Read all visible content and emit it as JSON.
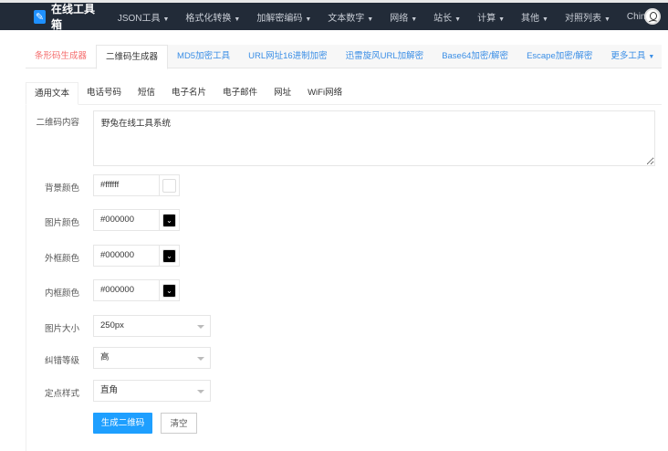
{
  "nav": {
    "brand": "在线工具箱",
    "items": [
      "JSON工具",
      "格式化转换",
      "加解密编码",
      "文本数字",
      "网络",
      "站长",
      "计算",
      "其他",
      "对照列表",
      "China"
    ]
  },
  "tabs": [
    "条形码生成器",
    "二维码生成器",
    "MD5加密工具",
    "URL网址16进制加密",
    "迅雷旋风URL加解密",
    "Base64加密/解密",
    "Escape加密/解密",
    "更多工具"
  ],
  "subtabs": [
    "通用文本",
    "电话号码",
    "短信",
    "电子名片",
    "电子邮件",
    "网址",
    "WiFi网络"
  ],
  "form": {
    "content_label": "二维码内容",
    "content_value": "野兔在线工具系统",
    "bg_label": "背景颜色",
    "bg_value": "#ffffff",
    "img_label": "图片颜色",
    "img_value": "#000000",
    "outer_label": "外框颜色",
    "outer_value": "#000000",
    "inner_label": "内框颜色",
    "inner_value": "#000000",
    "size_label": "图片大小",
    "size_value": "250px",
    "ec_label": "纠错等级",
    "ec_value": "高",
    "pos_label": "定点样式",
    "pos_value": "直角",
    "generate": "生成二维码",
    "clear": "清空"
  }
}
